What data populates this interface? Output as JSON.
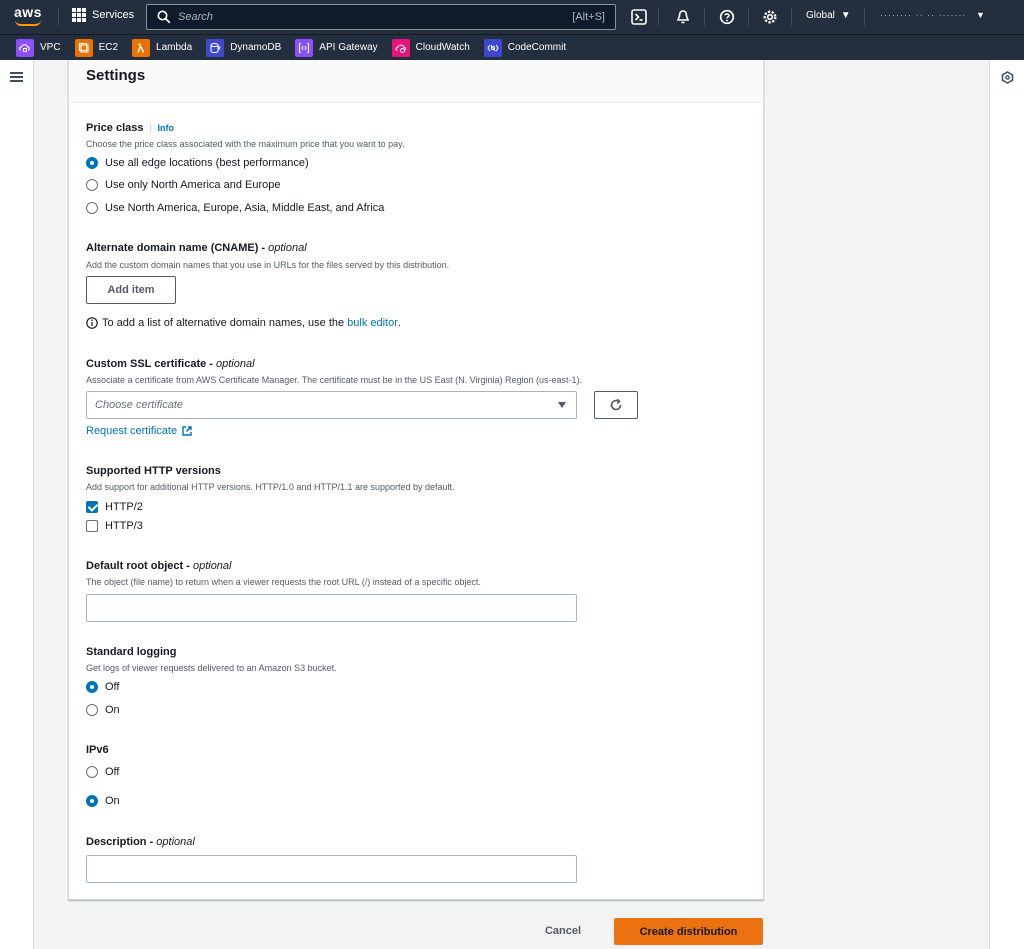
{
  "topnav": {
    "logo_text": "aws",
    "services_label": "Services",
    "search_placeholder": "Search",
    "search_shortcut": "[Alt+S]",
    "region_label": "Global",
    "account_label": "········  ·· ·· ·······"
  },
  "shortcuts": [
    {
      "label": "VPC",
      "color": "#8c4fff"
    },
    {
      "label": "EC2",
      "color": "#ed7100"
    },
    {
      "label": "Lambda",
      "color": "#ed7100"
    },
    {
      "label": "DynamoDB",
      "color": "#3f48cc"
    },
    {
      "label": "API Gateway",
      "color": "#8c4fff"
    },
    {
      "label": "CloudWatch",
      "color": "#e7157b"
    },
    {
      "label": "CodeCommit",
      "color": "#3f48cc"
    }
  ],
  "settings": {
    "title": "Settings",
    "price_class": {
      "label": "Price class",
      "info": "Info",
      "description": "Choose the price class associated with the maximum price that you want to pay.",
      "options": [
        "Use all edge locations (best performance)",
        "Use only North America and Europe",
        "Use North America, Europe, Asia, Middle East, and Africa"
      ]
    },
    "cname": {
      "label": "Alternate domain name (CNAME)",
      "optional": "optional",
      "description": "Add the custom domain names that you use in URLs for the files served by this distribution.",
      "add_item": "Add item",
      "hint_prefix": "To add a list of alternative domain names, use the",
      "hint_link": "bulk editor",
      "hint_suffix": "."
    },
    "ssl": {
      "label": "Custom SSL certificate",
      "optional": "optional",
      "description": "Associate a certificate from AWS Certificate Manager. The certificate must be in the US East (N. Virginia) Region (us-east-1).",
      "placeholder": "Choose certificate",
      "request_link": "Request certificate"
    },
    "http": {
      "label": "Supported HTTP versions",
      "description": "Add support for additional HTTP versions. HTTP/1.0 and HTTP/1.1 are supported by default.",
      "options": [
        "HTTP/2",
        "HTTP/3"
      ]
    },
    "root_object": {
      "label": "Default root object",
      "optional": "optional",
      "description": "The object (file name) to return when a viewer requests the root URL (/) instead of a specific object."
    },
    "logging": {
      "label": "Standard logging",
      "description": "Get logs of viewer requests delivered to an Amazon S3 bucket.",
      "options": [
        "Off",
        "On"
      ]
    },
    "ipv6": {
      "label": "IPv6",
      "options": [
        "Off",
        "On"
      ]
    },
    "description_field": {
      "label": "Description",
      "optional": "optional"
    }
  },
  "footer": {
    "cancel": "Cancel",
    "create": "Create distribution"
  },
  "colors": {
    "nav_bg": "#232f3e",
    "accent": "#0073bb",
    "primary_button": "#ec7211"
  }
}
